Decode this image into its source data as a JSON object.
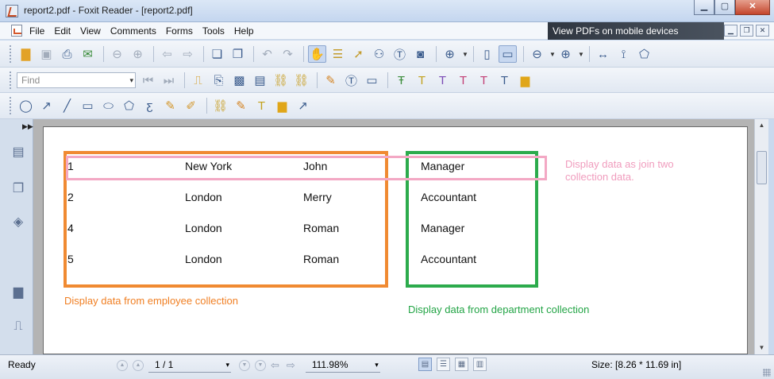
{
  "window": {
    "title": "report2.pdf - Foxit Reader - [report2.pdf]"
  },
  "menu": {
    "items": [
      "File",
      "Edit",
      "View",
      "Comments",
      "Forms",
      "Tools",
      "Help"
    ]
  },
  "banner": {
    "text": "View PDFs on mobile devices"
  },
  "search": {
    "placeholder": "Find"
  },
  "document": {
    "employee_rows": [
      {
        "id": "1",
        "city": "New York",
        "name": "John"
      },
      {
        "id": "2",
        "city": "London",
        "name": "Merry"
      },
      {
        "id": "4",
        "city": "London",
        "name": "Roman"
      },
      {
        "id": "5",
        "city": "London",
        "name": "Roman"
      }
    ],
    "department_rows": [
      "Manager",
      "Accountant",
      "Manager",
      "Accountant"
    ],
    "annotations": {
      "employee": "Display data from employee collection",
      "department": "Display data from department collection",
      "join_line1": "Display data as join two",
      "join_line2": "collection data."
    },
    "colors": {
      "employee": "#f08a32",
      "department": "#2cab4c",
      "join": "#f3a8c4"
    }
  },
  "status": {
    "ready": "Ready",
    "page": "1 / 1",
    "zoom": "111.98%",
    "size": "Size: [8.26 * 11.69 in]"
  }
}
